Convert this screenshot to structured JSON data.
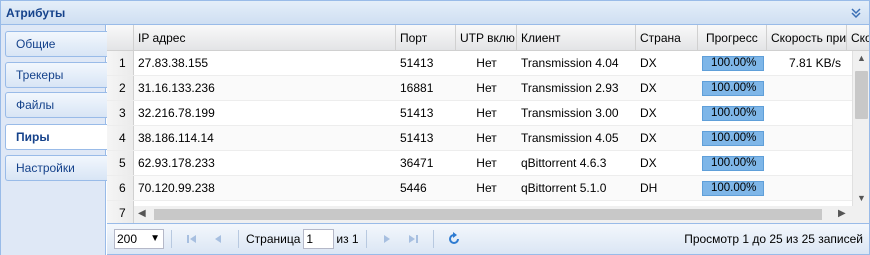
{
  "panel": {
    "title": "Атрибуты"
  },
  "tabs": [
    {
      "label": "Общие",
      "active": false
    },
    {
      "label": "Трекеры",
      "active": false
    },
    {
      "label": "Файлы",
      "active": false
    },
    {
      "label": "Пиры",
      "active": true
    },
    {
      "label": "Настройки",
      "active": false
    }
  ],
  "grid": {
    "columns": [
      "",
      "IP адрес",
      "Порт",
      "UTP вклю",
      "Клиент",
      "Страна",
      "Прогресс",
      "Скорость при",
      "Ско"
    ],
    "rows": [
      {
        "num": "1",
        "ip": "27.83.38.155",
        "port": "51413",
        "utp": "Нет",
        "client": "Transmission 4.04",
        "country": "DX",
        "progress": "100.00%",
        "speed": "7.81 KB/s"
      },
      {
        "num": "2",
        "ip": "31.16.133.236",
        "port": "16881",
        "utp": "Нет",
        "client": "Transmission 2.93",
        "country": "DX",
        "progress": "100.00%",
        "speed": ""
      },
      {
        "num": "3",
        "ip": "32.216.78.199",
        "port": "51413",
        "utp": "Нет",
        "client": "Transmission 3.00",
        "country": "DX",
        "progress": "100.00%",
        "speed": ""
      },
      {
        "num": "4",
        "ip": "38.186.114.14",
        "port": "51413",
        "utp": "Нет",
        "client": "Transmission 4.05",
        "country": "DX",
        "progress": "100.00%",
        "speed": ""
      },
      {
        "num": "5",
        "ip": "62.93.178.233",
        "port": "36471",
        "utp": "Нет",
        "client": "qBittorrent 4.6.3",
        "country": "DX",
        "progress": "100.00%",
        "speed": ""
      },
      {
        "num": "6",
        "ip": "70.120.99.238",
        "port": "5446",
        "utp": "Нет",
        "client": "qBittorrent 5.1.0",
        "country": "DH",
        "progress": "100.00%",
        "speed": ""
      },
      {
        "num": "7",
        "ip": "",
        "port": "",
        "utp": "",
        "client": "",
        "country": "",
        "progress": "",
        "speed": ""
      }
    ]
  },
  "pager": {
    "page_size": "200",
    "page_label": "Страница",
    "page_value": "1",
    "of_label": "из 1",
    "display_msg": "Просмотр 1 до 25 из 25 записей"
  },
  "icons": {
    "collapse": "double-chevron-down-icon",
    "first": "first-page-icon",
    "prev": "prev-page-icon",
    "next": "next-page-icon",
    "last": "last-page-icon",
    "refresh": "refresh-icon"
  },
  "colors": {
    "header_text": "#15428b",
    "progress_fill": "#7eb6e8",
    "border": "#99bbe8"
  }
}
